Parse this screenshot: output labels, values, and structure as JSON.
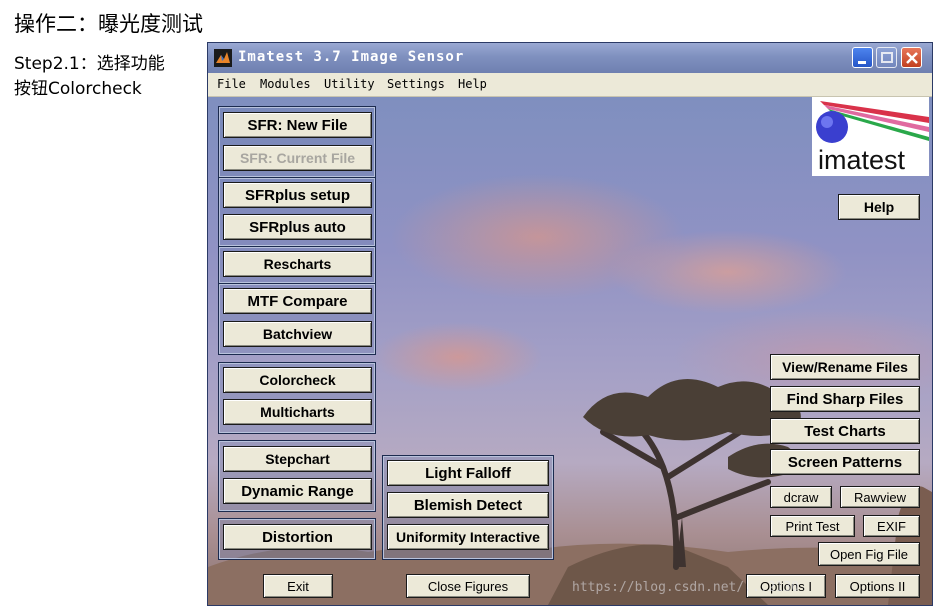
{
  "page": {
    "heading": "操作二：曝光度测试",
    "step_line1": "Step2.1：选择功能",
    "step_line2": "按钮Colorcheck"
  },
  "window": {
    "title": "Imatest 3.7  Image Sensor",
    "controls": {
      "minimize": "minimize-icon",
      "maximize": "maximize-icon",
      "close": "close-icon"
    }
  },
  "menu": [
    "File",
    "Modules",
    "Utility",
    "Settings",
    "Help"
  ],
  "left_buttons": {
    "sfr_new_file": "SFR: New File",
    "sfr_current_file": "SFR: Current File",
    "sfrplus_setup": "SFRplus  setup",
    "sfrplus_auto": "SFRplus  auto",
    "rescharts": "Rescharts",
    "mtf_compare": "MTF Compare",
    "batchview": "Batchview",
    "colorcheck": "Colorcheck",
    "multicharts": "Multicharts",
    "stepchart": "Stepchart",
    "dynamic_range": "Dynamic Range",
    "distortion": "Distortion"
  },
  "middle_buttons": {
    "light_falloff": "Light Falloff",
    "blemish_detect": "Blemish Detect",
    "uniformity_interactive": "Uniformity Interactive"
  },
  "right_buttons": {
    "help": "Help",
    "view_rename_files": "View/Rename Files",
    "find_sharp_files": "Find Sharp Files",
    "test_charts": "Test Charts",
    "screen_patterns": "Screen Patterns",
    "dcraw": "dcraw",
    "rawview": "Rawview",
    "print_test": "Print Test",
    "exif": "EXIF",
    "open_fig_file": "Open Fig File"
  },
  "bottom_buttons": {
    "exit": "Exit",
    "close_figures": "Close Figures",
    "options_1": "Options I",
    "options_2": "Options II"
  },
  "logo": {
    "text": "imatest"
  },
  "watermark": "https://blog.csdn.net/...2130",
  "colors": {
    "titlebar": "#7f90bf",
    "menubar": "#ece9d8",
    "button_face": "#ece9d8",
    "close_button": "#c2401f"
  }
}
